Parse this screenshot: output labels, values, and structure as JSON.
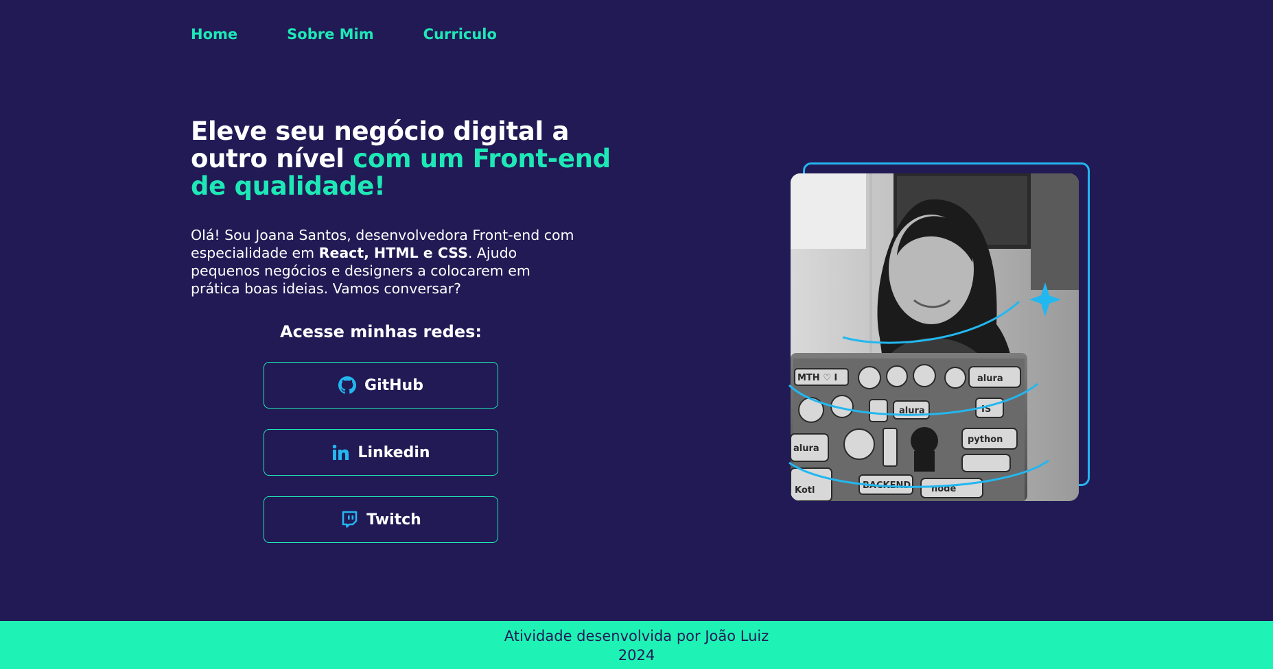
{
  "nav": {
    "items": [
      "Home",
      "Sobre Mim",
      "Curriculo"
    ]
  },
  "hero": {
    "headline_white": "Eleve seu negócio digital a outro nível ",
    "headline_accent": "com um Front-end de qualidade!",
    "intro_part1": "Olá! Sou Joana Santos, desenvolvedora Front-end com especialidade em ",
    "intro_bold": "React, HTML e CSS",
    "intro_part2": ". Ajudo pequenos negócios e designers a colocarem em prática boas ideias. Vamos conversar?",
    "networks_title": "Acesse minhas redes:",
    "buttons": [
      {
        "label": "GitHub",
        "icon": "github-icon"
      },
      {
        "label": "Linkedin",
        "icon": "linkedin-icon"
      },
      {
        "label": "Twitch",
        "icon": "twitch-icon"
      }
    ],
    "photo": {
      "icon": "portrait-photo",
      "sticker_texts": [
        "MTH ♡ I",
        "alura",
        "alura",
        "IS",
        "python",
        "alura",
        "BACKEND",
        "node",
        "Kotl"
      ]
    }
  },
  "footer": {
    "line1": "Atividade desenvolvida por João Luiz",
    "line2": "2024"
  },
  "colors": {
    "background": "#221a55",
    "accent": "#1ee8b6",
    "frame": "#23b7ef",
    "footer": "#1ef3b5"
  }
}
